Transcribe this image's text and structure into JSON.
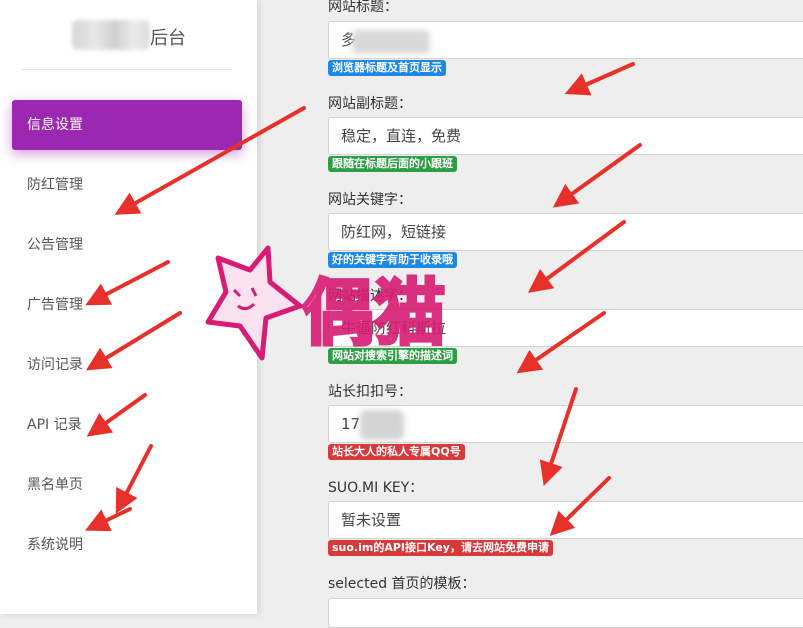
{
  "sidebar": {
    "brand_suffix": "后台",
    "items": [
      {
        "label": "信息设置",
        "active": true
      },
      {
        "label": "防红管理"
      },
      {
        "label": "公告管理"
      },
      {
        "label": "广告管理"
      },
      {
        "label": "访问记录"
      },
      {
        "label": "API 记录"
      },
      {
        "label": "黑名单页"
      },
      {
        "label": "系统说明"
      }
    ]
  },
  "form": {
    "site_title": {
      "label": "网站标题：",
      "value": "多",
      "hint": "浏览器标题及首页显示"
    },
    "site_subtitle": {
      "label": "网站副标题：",
      "value": "稳定，直连，免费",
      "hint": "跟随在标题后面的小跟班"
    },
    "site_keywords": {
      "label": "网站关键字：",
      "value": "防红网，短链接",
      "hint": "好的关键字有助于收录哦"
    },
    "site_description": {
      "label": "网站描述字：",
      "value": "牛逼防红科斯拉",
      "hint": "网站对搜索引擎的描述词"
    },
    "admin_qq": {
      "label": "站长扣扣号：",
      "value": "17     2",
      "hint": "站长大人的私人专属QQ号"
    },
    "suo_key": {
      "label": "SUO.MI KEY：",
      "value": "暂未设置",
      "hint": "suo.im的API接口Key，请去网站免费申请"
    },
    "template": {
      "label": "selected 首页的模板："
    }
  },
  "watermark": {
    "text": "偶猫"
  },
  "colors": {
    "accent": "#9c27b0",
    "hint_blue": "#1e88e5",
    "hint_green": "#2e9e45",
    "hint_red": "#d63a3a",
    "arrow": "#e8302a",
    "watermark": "#d81b74"
  }
}
